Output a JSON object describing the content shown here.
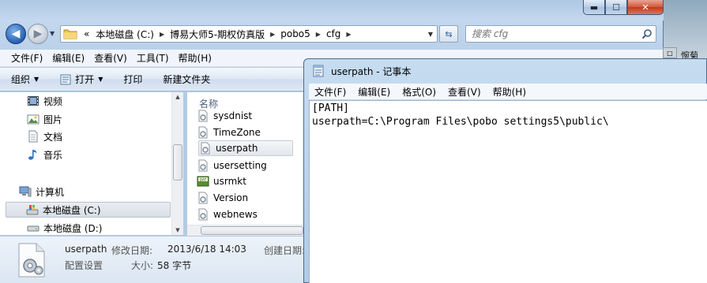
{
  "explorer": {
    "address": {
      "overflow": "«",
      "crumbs": [
        "本地磁盘 (C:)",
        "博易大师5-期权仿真版",
        "pobo5",
        "cfg"
      ]
    },
    "search": {
      "placeholder": "搜索 cfg"
    },
    "menu": [
      "文件(F)",
      "编辑(E)",
      "查看(V)",
      "工具(T)",
      "帮助(H)"
    ],
    "commands": {
      "organize": "组织",
      "open": "打开",
      "print": "打印",
      "new_folder": "新建文件夹"
    },
    "nav": {
      "libraries": [
        {
          "label": "视频",
          "icon": "video-library-icon"
        },
        {
          "label": "图片",
          "icon": "picture-library-icon"
        },
        {
          "label": "文档",
          "icon": "document-library-icon"
        },
        {
          "label": "音乐",
          "icon": "music-library-icon"
        }
      ],
      "computer": "计算机",
      "drives": [
        {
          "label": "本地磁盘 (C:)",
          "selected": true
        },
        {
          "label": "本地磁盘 (D:)",
          "selected": false
        }
      ]
    },
    "files": {
      "column_name": "名称",
      "items": [
        {
          "name": "sysdnist",
          "icon": "config-file-icon"
        },
        {
          "name": "TimeZone",
          "icon": "config-file-icon"
        },
        {
          "name": "userpath",
          "icon": "config-file-icon",
          "selected": true
        },
        {
          "name": "usersetting",
          "icon": "config-file-icon"
        },
        {
          "name": "usrmkt",
          "icon": "dat-file-icon"
        },
        {
          "name": "Version",
          "icon": "config-file-icon"
        },
        {
          "name": "webnews",
          "icon": "config-file-icon"
        }
      ]
    },
    "details": {
      "name": "userpath",
      "type": "配置设置",
      "modified_label": "修改日期:",
      "modified_value": "2013/6/18 14:03",
      "size_label": "大小:",
      "size_value": "58 字节",
      "created_label": "创建日期:"
    }
  },
  "notepad": {
    "title": "userpath - 记事本",
    "menu": [
      "文件(F)",
      "编辑(E)",
      "格式(O)",
      "查看(V)",
      "帮助(H)"
    ],
    "content": "[PATH]\nuserpath=C:\\Program Files\\pobo settings5\\public\\"
  },
  "background": {
    "label": "惋菊"
  },
  "colors": {
    "accent": "#2660b4",
    "window_frame": "#b3cbe5",
    "close_button": "#c2391a"
  }
}
